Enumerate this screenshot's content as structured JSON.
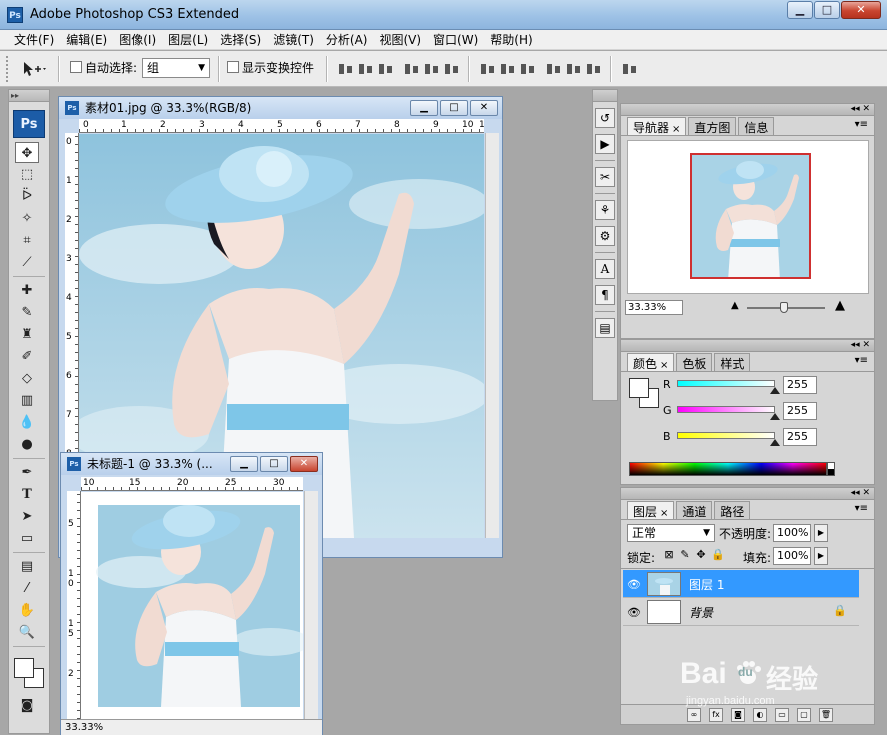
{
  "app": {
    "title": "Adobe Photoshop CS3 Extended",
    "logo": "Ps"
  },
  "window_buttons": {
    "minimize": "▁",
    "maximize": "□",
    "close": "✕"
  },
  "menu": [
    "文件(F)",
    "编辑(E)",
    "图像(I)",
    "图层(L)",
    "选择(S)",
    "滤镜(T)",
    "分析(A)",
    "视图(V)",
    "窗口(W)",
    "帮助(H)"
  ],
  "options": {
    "auto_select_label": "自动选择:",
    "auto_select_value": "组",
    "show_transform_label": "显示变换控件"
  },
  "toolbox": {
    "logo": "Ps"
  },
  "doc1": {
    "title": "素材01.jpg @ 33.3%(RGB/8)",
    "ruler_h": [
      "0",
      "1",
      "2",
      "3",
      "4",
      "5",
      "6",
      "7",
      "8",
      "9",
      "10",
      "1"
    ],
    "ruler_v": [
      "0",
      "1",
      "2",
      "3",
      "4",
      "5",
      "6",
      "7",
      "8"
    ]
  },
  "doc2": {
    "title": "未标题-1 @ 33.3% (...",
    "ruler_h": [
      "10",
      "15",
      "20",
      "25",
      "30"
    ],
    "ruler_v": [
      "5",
      "1",
      "0",
      "1",
      "5",
      "2"
    ],
    "status": "33.33%"
  },
  "navigator": {
    "tabs": [
      {
        "label": "导航器",
        "close": "×"
      },
      {
        "label": "直方图"
      },
      {
        "label": "信息"
      }
    ],
    "zoom": "33.33%"
  },
  "color": {
    "tabs": [
      {
        "label": "颜色",
        "close": "×"
      },
      {
        "label": "色板"
      },
      {
        "label": "样式"
      }
    ],
    "channels": [
      {
        "label": "R",
        "value": "255",
        "color": "#22cccc"
      },
      {
        "label": "G",
        "value": "255",
        "color": "#cc33cc"
      },
      {
        "label": "B",
        "value": "255",
        "color": "#dddd22"
      }
    ]
  },
  "layers": {
    "tabs": [
      {
        "label": "图层",
        "close": "×"
      },
      {
        "label": "通道"
      },
      {
        "label": "路径"
      }
    ],
    "blend_mode": "正常",
    "opacity_label": "不透明度:",
    "opacity_value": "100%",
    "lock_label": "锁定:",
    "fill_label": "填充:",
    "fill_value": "100%",
    "items": [
      {
        "name": "图层 1",
        "selected": true
      },
      {
        "name": "背景",
        "locked": true
      }
    ]
  },
  "watermark": {
    "brand": "Bai",
    "paw": "du",
    "suffix": "经验",
    "url": "jingyan.baidu.com"
  },
  "colors": {
    "selection": "#3399ff",
    "titlebar": "#9ec2e6",
    "nav_frame": "#cf3030"
  }
}
